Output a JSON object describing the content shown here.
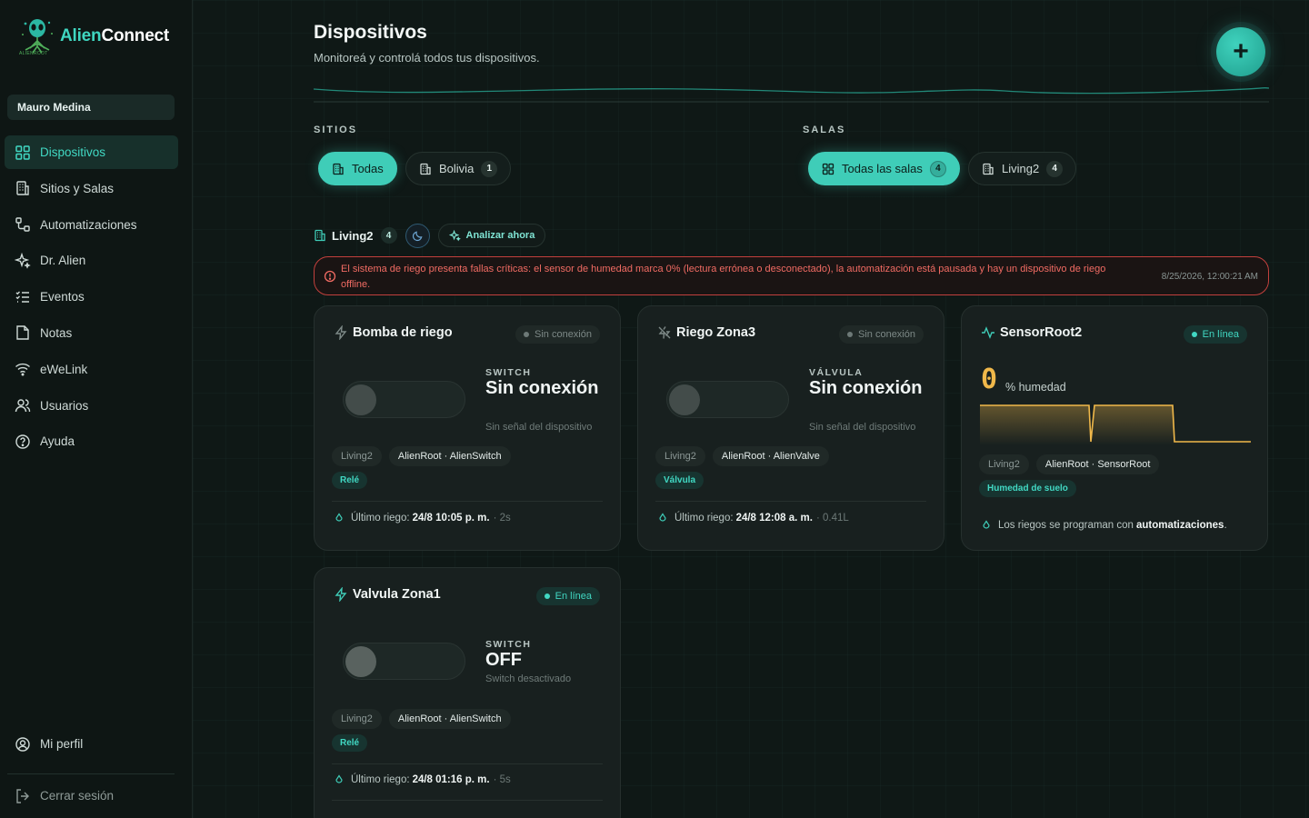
{
  "app": {
    "name_part1": "Alien",
    "name_part2": "Connect",
    "sub_brand": "ALIENROOT"
  },
  "user": {
    "name": "Mauro Medina"
  },
  "nav": [
    {
      "label": "Dispositivos",
      "icon": "grid-icon",
      "active": true
    },
    {
      "label": "Sitios y Salas",
      "icon": "building-icon"
    },
    {
      "label": "Automatizaciones",
      "icon": "workflow-icon"
    },
    {
      "label": "Dr. Alien",
      "icon": "sparkles-icon"
    },
    {
      "label": "Eventos",
      "icon": "list-checks-icon"
    },
    {
      "label": "Notas",
      "icon": "note-icon"
    },
    {
      "label": "eWeLink",
      "icon": "wifi-icon"
    },
    {
      "label": "Usuarios",
      "icon": "users-icon"
    },
    {
      "label": "Ayuda",
      "icon": "help-circle-icon"
    }
  ],
  "nav_bottom": {
    "profile": "Mi perfil",
    "logout": "Cerrar sesión"
  },
  "header": {
    "title": "Dispositivos",
    "subtitle": "Monitoreá y controlá todos tus dispositivos.",
    "add_button": "+"
  },
  "filters": {
    "sites_label": "SITIOS",
    "rooms_label": "SALAS",
    "sites": [
      {
        "label": "Todas",
        "active": true
      },
      {
        "label": "Bolivia",
        "count": "1"
      }
    ],
    "rooms": [
      {
        "label": "Todas las salas",
        "count": "4",
        "active": true
      },
      {
        "label": "Living2",
        "count": "4"
      }
    ]
  },
  "room": {
    "name": "Living2",
    "count": "4",
    "analyze_label": "Analizar ahora"
  },
  "alert": {
    "message": "El sistema de riego presenta fallas críticas: el sensor de humedad marca 0% (lectura errónea o desconectado), la automatización está pausada y hay un dispositivo de riego offline.",
    "timestamp": "8/25/2026, 12:00:21 AM"
  },
  "devices": [
    {
      "name": "Bomba de riego",
      "status": "Sin conexión",
      "kind": "SWITCH",
      "state": "Sin conexión",
      "state_sub": "Sin señal del dispositivo",
      "room": "Living2",
      "model": "AlienRoot · AlienSwitch",
      "type": "Relé",
      "last_label": "Último riego:",
      "last_value": "24/8 10:05 p. m.",
      "last_extra": "· 2s"
    },
    {
      "name": "Riego Zona3",
      "status": "Sin conexión",
      "kind": "VÁLVULA",
      "state": "Sin conexión",
      "state_sub": "Sin señal del dispositivo",
      "room": "Living2",
      "model": "AlienRoot · AlienValve",
      "type": "Válvula",
      "last_label": "Último riego:",
      "last_value": "24/8 12:08 a. m.",
      "last_extra": "· 0.41L"
    },
    {
      "name": "SensorRoot2",
      "status": "En línea",
      "value": "0",
      "unit": "% humedad",
      "room": "Living2",
      "model": "AlienRoot · SensorRoot",
      "type": "Humedad de suelo",
      "note_prefix": "Los riegos se programan con",
      "note_link": "automatizaciones",
      "note_suffix": "."
    },
    {
      "name": "Valvula Zona1",
      "status": "En línea",
      "kind": "SWITCH",
      "state": "OFF",
      "state_sub": "Switch desactivado",
      "room": "Living2",
      "model": "AlienRoot · AlienSwitch",
      "type": "Relé",
      "last_label": "Último riego:",
      "last_value": "24/8 01:16 p. m.",
      "last_extra": "· 5s"
    }
  ],
  "colors": {
    "accent": "#3fcdb8",
    "alert": "#c2403d",
    "sensor": "#f0b84a",
    "background": "#0f1816"
  }
}
